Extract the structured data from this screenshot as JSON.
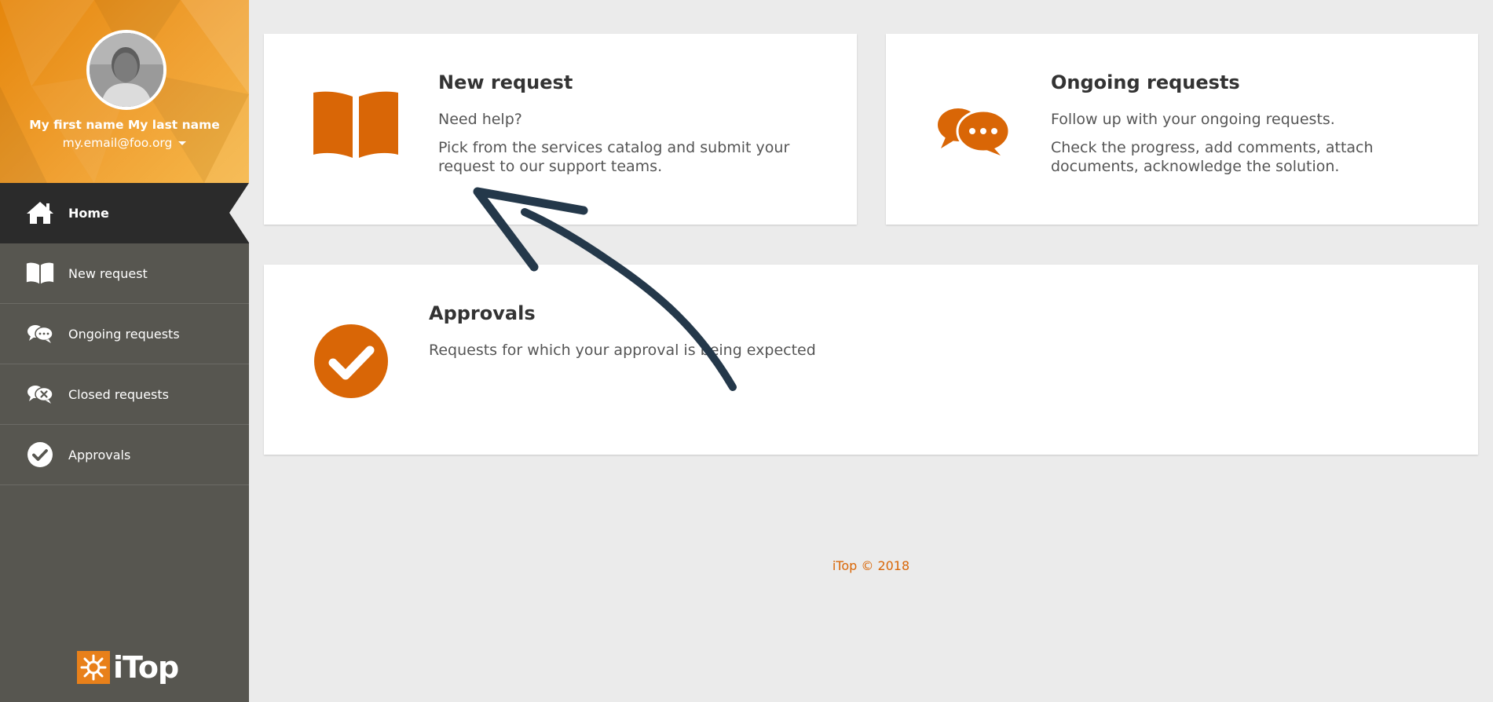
{
  "user": {
    "name": "My first name My last name",
    "email": "my.email@foo.org"
  },
  "menu": {
    "items": [
      {
        "label": "Home",
        "icon": "home-icon",
        "active": true
      },
      {
        "label": "New request",
        "icon": "book-icon"
      },
      {
        "label": "Ongoing requests",
        "icon": "chat-bubbles-icon"
      },
      {
        "label": "Closed requests",
        "icon": "chat-closed-icon"
      },
      {
        "label": "Approvals",
        "icon": "check-circle-icon"
      }
    ]
  },
  "brand": {
    "name": "iTop"
  },
  "tiles": {
    "new_request": {
      "title": "New request",
      "line1": "Need help?",
      "line2": "Pick from the services catalog and submit your request to our support teams."
    },
    "ongoing": {
      "title": "Ongoing requests",
      "line1": "Follow up with your ongoing requests.",
      "line2": "Check the progress, add comments, attach documents, acknowledge the solution."
    },
    "approvals": {
      "title": "Approvals",
      "line1": "Requests for which your approval is being expected"
    }
  },
  "footer": {
    "text": "iTop © 2018"
  },
  "colors": {
    "accent": "#d96606",
    "sidebar": "#575650",
    "active_menu": "#2b2b2b",
    "background": "#ebebeb",
    "annotation_arrow": "#24384a"
  }
}
